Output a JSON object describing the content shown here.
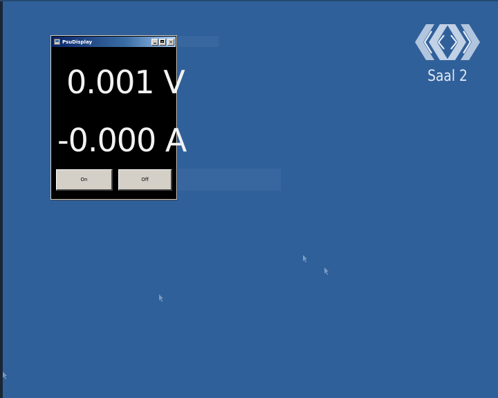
{
  "window": {
    "title": "PsuDisplay",
    "minimize_label": "",
    "maximize_label": "",
    "close_label": "×"
  },
  "readings": {
    "voltage": "0.001 V",
    "current": "-0.000 A"
  },
  "buttons": {
    "on_label": "On",
    "off_label": "Off"
  },
  "overlay": {
    "room_label": "Saal 2"
  },
  "colors": {
    "desktop": "#30609a",
    "display_background": "#000000",
    "display_text": "#f2f2f2"
  }
}
